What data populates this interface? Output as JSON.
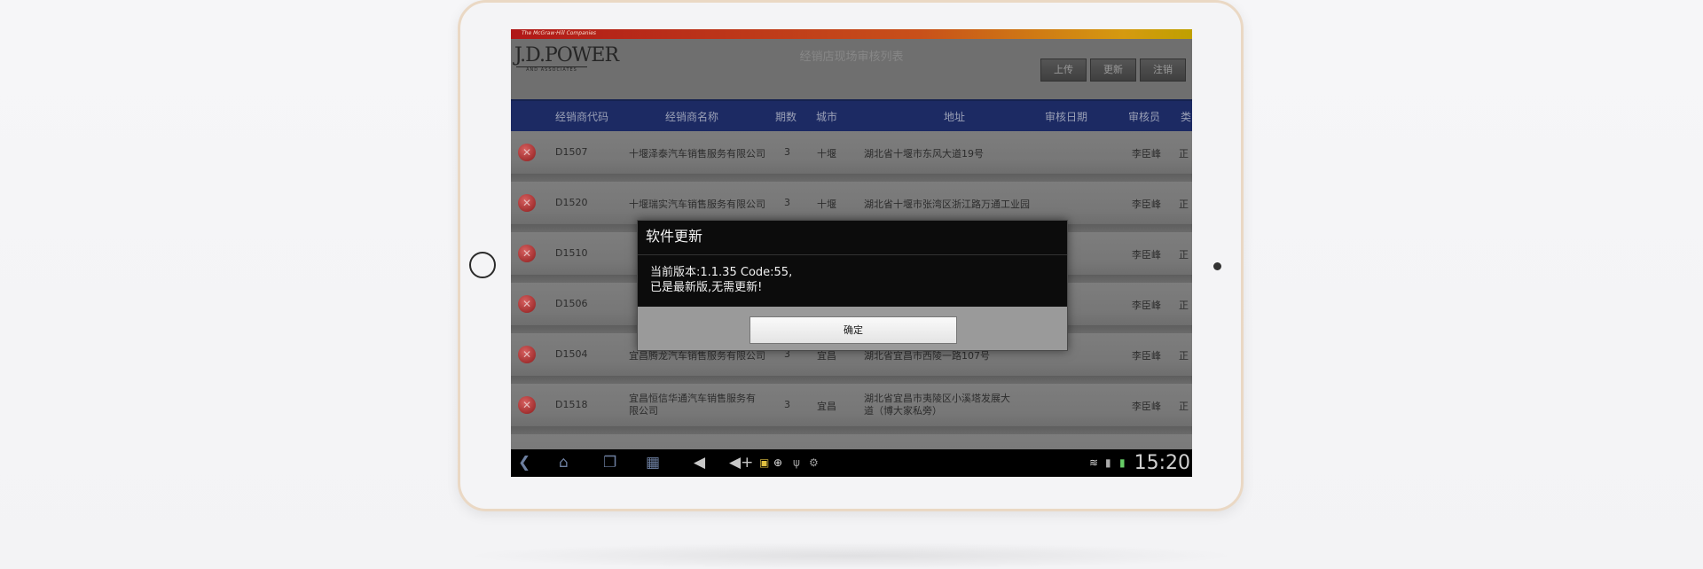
{
  "app": {
    "brand_small": "The McGraw·Hill Companies",
    "logo_text": "J.D.POWER",
    "logo_sub": "AND ASSOCIATES",
    "title": "经销店现场审核列表"
  },
  "toolbar": {
    "upload_label": "上传",
    "update_label": "更新",
    "logout_label": "注销"
  },
  "table": {
    "columns": [
      "经销商代码",
      "经销商名称",
      "期数",
      "城市",
      "地址",
      "审核日期",
      "审核员",
      "类"
    ],
    "rows": [
      {
        "code": "D1507",
        "name": "十堰泽泰汽车销售服务有限公司",
        "period": "3",
        "city": "十堰",
        "address": "湖北省十堰市东风大道19号",
        "date": "",
        "auditor": "李臣峰",
        "type": "正"
      },
      {
        "code": "D1520",
        "name": "十堰瑞实汽车销售服务有限公司",
        "period": "3",
        "city": "十堰",
        "address": "湖北省十堰市张湾区浙江路万通工业园",
        "date": "",
        "auditor": "李臣峰",
        "type": "正"
      },
      {
        "code": "D1510",
        "name": "",
        "period": "",
        "city": "",
        "address": "",
        "date": "",
        "auditor": "李臣峰",
        "type": "正"
      },
      {
        "code": "D1506",
        "name": "",
        "period": "",
        "city": "",
        "address": "",
        "date": "",
        "auditor": "李臣峰",
        "type": "正"
      },
      {
        "code": "D1504",
        "name": "宜昌腾龙汽车销售服务有限公司",
        "period": "3",
        "city": "宜昌",
        "address": "湖北省宜昌市西陵一路107号",
        "date": "",
        "auditor": "李臣峰",
        "type": "正"
      },
      {
        "code": "D1518",
        "name": "宜昌恒信华通汽车销售服务有限公司",
        "period": "3",
        "city": "宜昌",
        "address": "湖北省宜昌市夷陵区小溪塔发展大道（博大家私旁）",
        "date": "",
        "auditor": "李臣峰",
        "type": "正"
      }
    ]
  },
  "dialog": {
    "title": "软件更新",
    "line1": "当前版本:1.1.35 Code:55,",
    "line2": "已是最新版,无需更新!",
    "ok_label": "确定"
  },
  "status_bar": {
    "time": "15:20"
  },
  "colors": {
    "header_bar": "#1c2a63",
    "accent_red": "#b01818",
    "tablet_frame": "#ead8c4"
  }
}
